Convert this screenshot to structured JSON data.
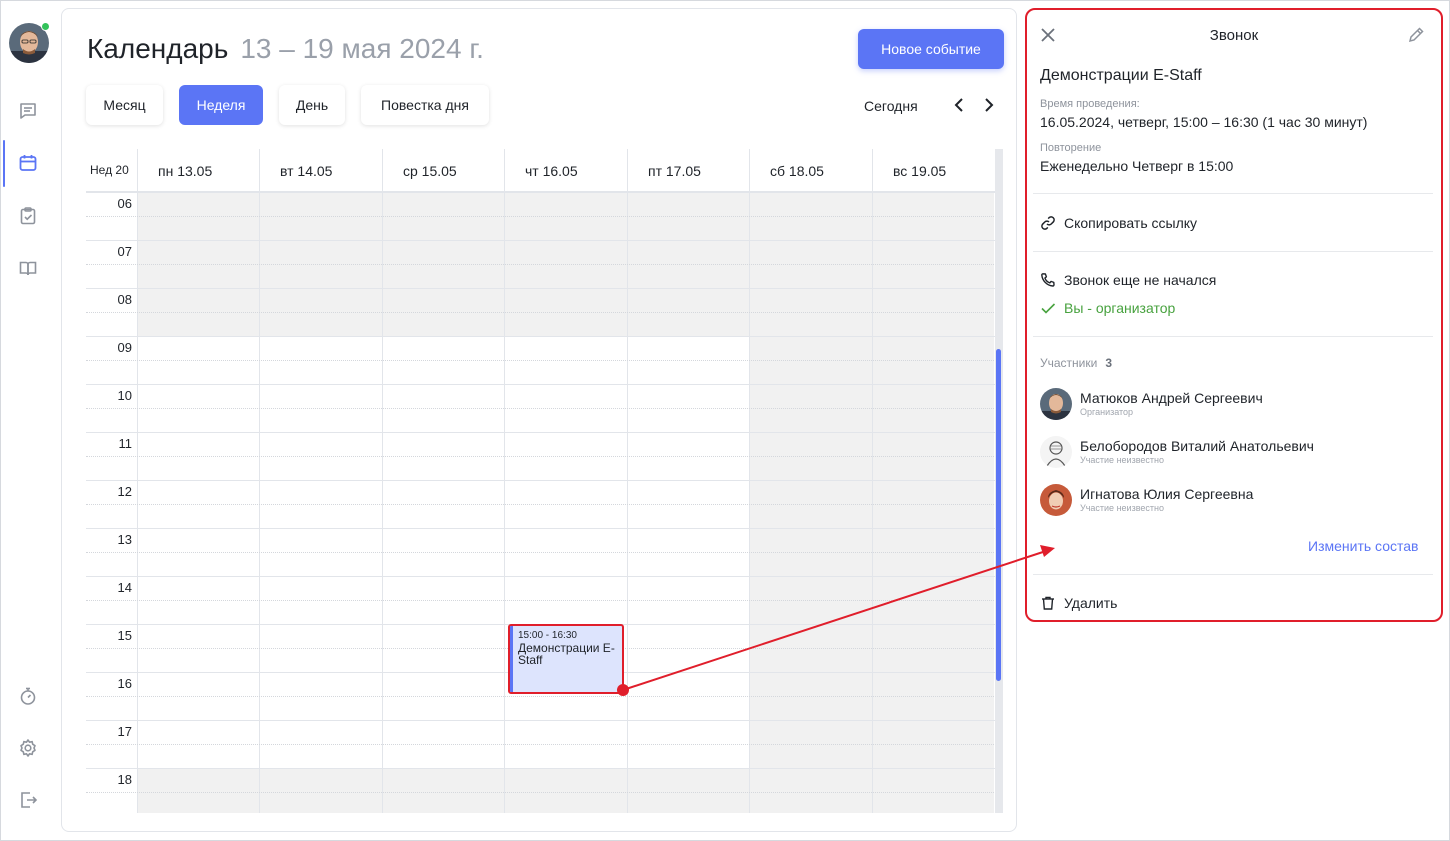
{
  "sidebar": {
    "items": [
      {
        "name": "messages",
        "icon": "chat-icon"
      },
      {
        "name": "calendar",
        "icon": "calendar-icon",
        "active": true
      },
      {
        "name": "tasks",
        "icon": "clipboard-check-icon"
      },
      {
        "name": "knowledge",
        "icon": "book-icon"
      }
    ],
    "bottom": [
      {
        "name": "timer",
        "icon": "stopwatch-icon"
      },
      {
        "name": "settings",
        "icon": "gear-icon"
      },
      {
        "name": "logout",
        "icon": "logout-icon"
      }
    ],
    "accent": "#5b75f5"
  },
  "header": {
    "title": "Календарь",
    "range": "13 – 19 мая 2024 г.",
    "new_event": "Новое событие"
  },
  "views": [
    {
      "label": "Месяц",
      "active": false
    },
    {
      "label": "Неделя",
      "active": true
    },
    {
      "label": "День",
      "active": false
    },
    {
      "label": "Повестка дня",
      "active": false
    }
  ],
  "nav": {
    "today": "Сегодня"
  },
  "calendar": {
    "week_label": "Нед 20",
    "days": [
      "пн 13.05",
      "вт 14.05",
      "ср 15.05",
      "чт 16.05",
      "пт 17.05",
      "сб 18.05",
      "вс 19.05"
    ],
    "hours": [
      "06",
      "07",
      "08",
      "09",
      "10",
      "11",
      "12",
      "13",
      "14",
      "15",
      "16",
      "17",
      "18"
    ],
    "event": {
      "time": "15:00 - 16:30",
      "title": "Демонстрации E-Staff",
      "day_index": 3
    }
  },
  "panel": {
    "title": "Звонок",
    "event_name": "Демонстрации E-Staff",
    "time_label": "Время проведения:",
    "time_value": "16.05.2024, четверг, 15:00 – 16:30 (1 час 30 минут)",
    "repeat_label": "Повторение",
    "repeat_value": "Еженедельно Четверг в 15:00",
    "copy_link": "Скопировать ссылку",
    "call_status": "Звонок еще не начался",
    "organizer_note": "Вы - организатор",
    "participants_label": "Участники",
    "participants_count": "3",
    "participants": [
      {
        "name": "Матюков Андрей Сергеевич",
        "role": "Организатор"
      },
      {
        "name": "Белобородов Виталий Анатольевич",
        "role": "Участие неизвестно"
      },
      {
        "name": "Игнатова Юлия Сергеевна",
        "role": "Участие неизвестно"
      }
    ],
    "change_members": "Изменить состав",
    "delete": "Удалить",
    "highlight_color": "#e01e2b"
  }
}
